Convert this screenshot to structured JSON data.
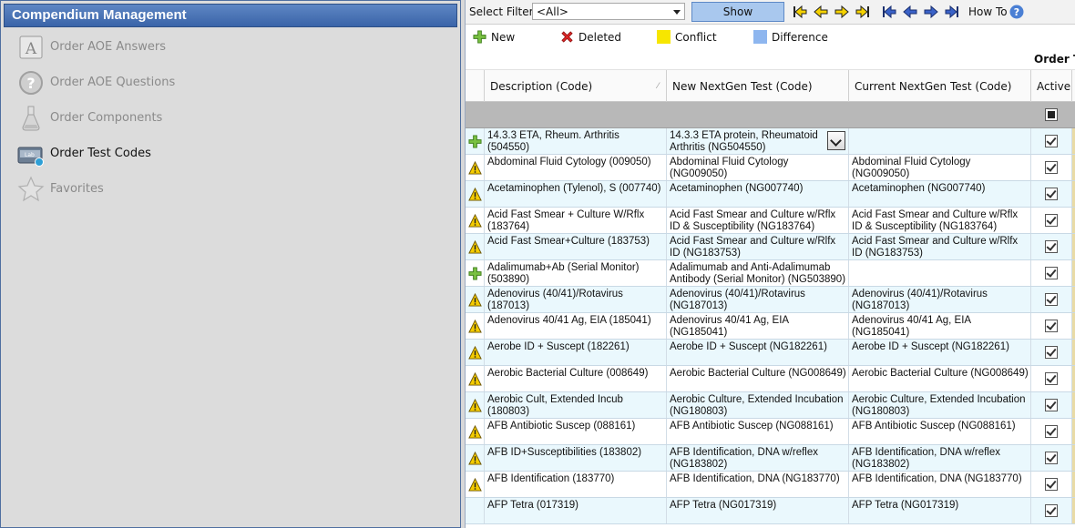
{
  "left_panel": {
    "title": "Compendium Management",
    "items": [
      {
        "label": "Order AOE Answers",
        "icon": "aoe-answers-icon",
        "active": false
      },
      {
        "label": "Order AOE Questions",
        "icon": "question-icon",
        "active": false
      },
      {
        "label": "Order Components",
        "icon": "components-flask-icon",
        "active": false
      },
      {
        "label": "Order Test Codes",
        "icon": "lab-test-codes-icon",
        "active": true
      },
      {
        "label": "Favorites",
        "icon": "star-icon",
        "active": false
      }
    ]
  },
  "toolbar": {
    "filter_label": "Select Filter:",
    "filter_value": "<All>",
    "show_differences_label": "Show Differences",
    "how_to_label": "How To",
    "nav_icons": [
      "first-difference-icon",
      "previous-difference-icon",
      "next-difference-icon",
      "last-difference-icon",
      "first-record-icon",
      "previous-record-icon",
      "next-record-icon",
      "last-record-icon"
    ]
  },
  "legend": {
    "new_label": "New",
    "deleted_label": "Deleted",
    "conflict_label": "Conflict",
    "difference_label": "Difference",
    "conflict_color": "#f7e600",
    "difference_color": "#8eb6ef"
  },
  "grid": {
    "group_header": "Order Te",
    "columns": {
      "description": "Description (Code)",
      "new_test": "New NextGen Test (Code)",
      "current_test": "Current NextGen Test (Code)",
      "active": "Active"
    },
    "rows": [
      {
        "status": "new",
        "description": "14.3.3 ETA, Rheum. Arthritis (504550)",
        "new_test": "14.3.3 ETA protein, Rheumatoid Arthritis (NG504550)",
        "current_test": ""
      },
      {
        "status": "conflict",
        "description": "Abdominal Fluid Cytology (009050)",
        "new_test": "Abdominal Fluid Cytology (NG009050)",
        "current_test": "Abdominal Fluid Cytology (NG009050)"
      },
      {
        "status": "conflict",
        "description": "Acetaminophen (Tylenol), S (007740)",
        "new_test": "Acetaminophen (NG007740)",
        "current_test": "Acetaminophen (NG007740)"
      },
      {
        "status": "conflict",
        "description": "Acid Fast Smear + Culture W/Rflx (183764)",
        "new_test": "Acid Fast Smear and Culture w/Rflx ID & Susceptibility (NG183764)",
        "current_test": "Acid Fast Smear and Culture w/Rflx ID & Susceptibility (NG183764)"
      },
      {
        "status": "conflict",
        "description": "Acid Fast Smear+Culture (183753)",
        "new_test": "Acid Fast Smear and Culture w/Rlfx ID (NG183753)",
        "current_test": "Acid Fast Smear and Culture w/Rlfx ID (NG183753)"
      },
      {
        "status": "new",
        "description": "Adalimumab+Ab (Serial Monitor) (503890)",
        "new_test": "Adalimumab and Anti-Adalimumab Antibody (Serial Monitor) (NG503890)",
        "current_test": ""
      },
      {
        "status": "conflict",
        "description": "Adenovirus (40/41)/Rotavirus (187013)",
        "new_test": "Adenovirus (40/41)/Rotavirus (NG187013)",
        "current_test": "Adenovirus (40/41)/Rotavirus (NG187013)"
      },
      {
        "status": "conflict",
        "description": "Adenovirus 40/41 Ag, EIA (185041)",
        "new_test": "Adenovirus 40/41 Ag, EIA (NG185041)",
        "current_test": "Adenovirus 40/41 Ag, EIA (NG185041)"
      },
      {
        "status": "conflict",
        "description": "Aerobe ID + Suscept (182261)",
        "new_test": "Aerobe ID + Suscept (NG182261)",
        "current_test": "Aerobe ID + Suscept (NG182261)"
      },
      {
        "status": "conflict",
        "description": "Aerobic Bacterial Culture (008649)",
        "new_test": "Aerobic Bacterial Culture (NG008649)",
        "current_test": "Aerobic Bacterial Culture (NG008649)"
      },
      {
        "status": "conflict",
        "description": "Aerobic Cult, Extended Incub (180803)",
        "new_test": "Aerobic Culture, Extended Incubation (NG180803)",
        "current_test": "Aerobic Culture, Extended Incubation (NG180803)"
      },
      {
        "status": "conflict",
        "description": "AFB Antibiotic Suscep (088161)",
        "new_test": "AFB Antibiotic Suscep (NG088161)",
        "current_test": "AFB Antibiotic Suscep (NG088161)"
      },
      {
        "status": "conflict",
        "description": "AFB ID+Susceptibilities (183802)",
        "new_test": "AFB Identification, DNA w/reflex (NG183802)",
        "current_test": "AFB Identification, DNA w/reflex (NG183802)"
      },
      {
        "status": "conflict",
        "description": "AFB Identification (183770)",
        "new_test": "AFB Identification, DNA (NG183770)",
        "current_test": "AFB Identification, DNA (NG183770)"
      },
      {
        "status": "none",
        "description": "AFP Tetra (017319)",
        "new_test": "AFP Tetra (NG017319)",
        "current_test": "AFP Tetra (NG017319)"
      }
    ]
  }
}
